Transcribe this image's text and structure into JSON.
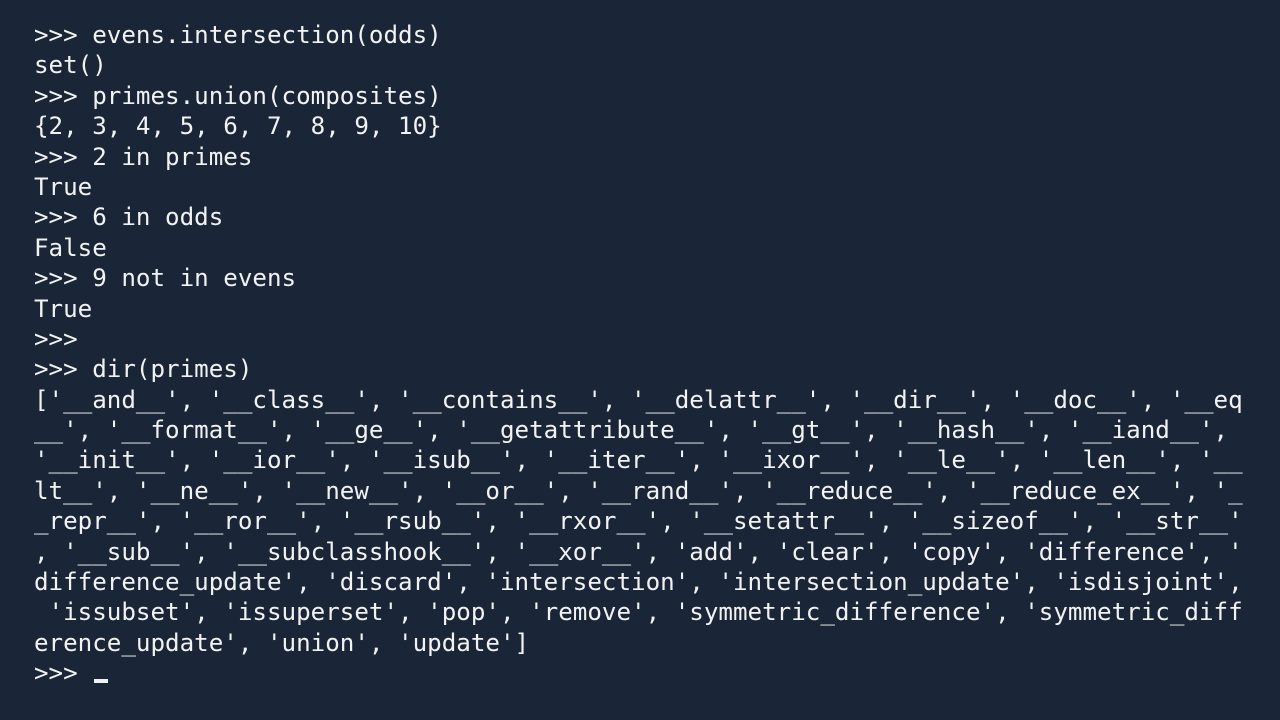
{
  "terminal": {
    "lines": [
      ">>> evens.intersection(odds)",
      "set()",
      ">>> primes.union(composites)",
      "{2, 3, 4, 5, 6, 7, 8, 9, 10}",
      ">>> 2 in primes",
      "True",
      ">>> 6 in odds",
      "False",
      ">>> 9 not in evens",
      "True",
      ">>>",
      ">>> dir(primes)",
      "['__and__', '__class__', '__contains__', '__delattr__', '__dir__', '__doc__', '__eq",
      "__', '__format__', '__ge__', '__getattribute__', '__gt__', '__hash__', '__iand__',",
      "'__init__', '__ior__', '__isub__', '__iter__', '__ixor__', '__le__', '__len__', '__",
      "lt__', '__ne__', '__new__', '__or__', '__rand__', '__reduce__', '__reduce_ex__', '_",
      "_repr__', '__ror__', '__rsub__', '__rxor__', '__setattr__', '__sizeof__', '__str__'",
      ", '__sub__', '__subclasshook__', '__xor__', 'add', 'clear', 'copy', 'difference', '",
      "difference_update', 'discard', 'intersection', 'intersection_update', 'isdisjoint',",
      " 'issubset', 'issuperset', 'pop', 'remove', 'symmetric_difference', 'symmetric_diff",
      "erence_update', 'union', 'update']"
    ],
    "prompt": ">>> "
  },
  "colors": {
    "background": "#1a2638",
    "text": "#f2f2f2"
  }
}
